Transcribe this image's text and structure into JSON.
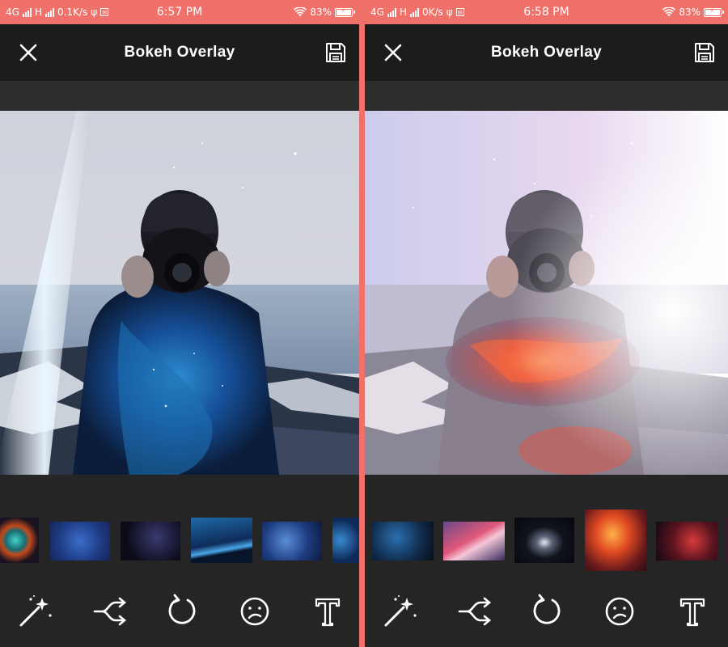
{
  "left": {
    "status": {
      "network": "4G",
      "network2": "H",
      "speed": "0.1K/s",
      "time": "6:57 PM",
      "battery": "83%"
    },
    "title": "Bokeh Overlay"
  },
  "right": {
    "status": {
      "network": "4G",
      "network2": "H",
      "speed": "0K/s",
      "time": "6:58 PM",
      "battery": "83%"
    },
    "title": "Bokeh Overlay"
  },
  "icons": {
    "close": "close-icon",
    "save": "save-icon",
    "toolbar": [
      "magic-wand-icon",
      "shuffle-icon",
      "rotate-icon",
      "sad-face-icon",
      "text-icon"
    ]
  },
  "colors": {
    "accent": "#f0716a",
    "appbar": "#1c1c1c",
    "background": "#252525"
  }
}
